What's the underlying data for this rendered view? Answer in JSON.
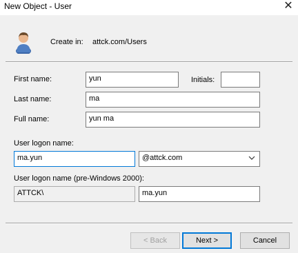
{
  "window": {
    "title": "New Object - User",
    "close_glyph": "✕"
  },
  "header": {
    "create_in_label": "Create in:",
    "create_in_path": "attck.com/Users"
  },
  "form": {
    "first_name": {
      "label": "First name:",
      "value": "yun"
    },
    "initials": {
      "label": "Initials:",
      "value": ""
    },
    "last_name": {
      "label": "Last name:",
      "value": "ma"
    },
    "full_name": {
      "label": "Full name:",
      "value": "yun ma"
    },
    "logon_name": {
      "label": "User logon name:",
      "value": "ma.yun",
      "domain_suffix": "@attck.com"
    },
    "pre2000": {
      "label": "User logon name (pre-Windows 2000):",
      "domain": "ATTCK\\",
      "value": "ma.yun"
    }
  },
  "buttons": {
    "back": "< Back",
    "next": "Next >",
    "cancel": "Cancel"
  },
  "colors": {
    "accent": "#0078d7",
    "background": "#f0f0f0"
  }
}
